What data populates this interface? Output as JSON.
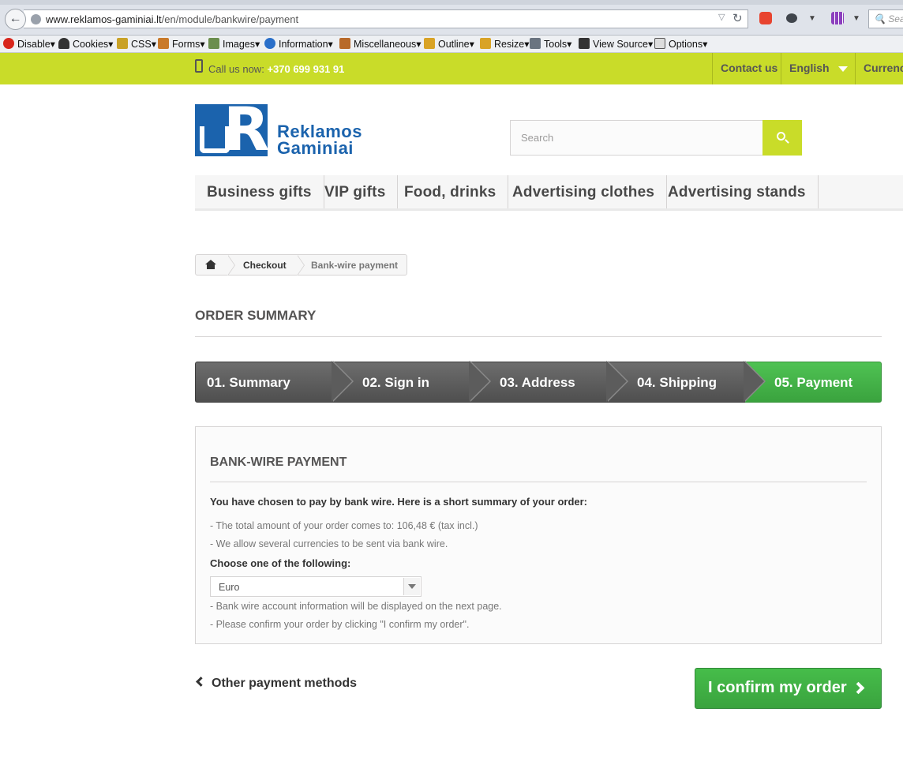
{
  "browser": {
    "url_host": "www.reklamos-gaminiai.lt",
    "url_path": "/en/module/bankwire/payment",
    "search_placeholder": "Sea"
  },
  "devtoolbar": {
    "items": [
      "Disable▾",
      "Cookies▾",
      "CSS▾",
      "Forms▾",
      "Images▾",
      "Information▾",
      "Miscellaneous▾",
      "Outline▾",
      "Resize▾",
      "Tools▾",
      "View Source▾",
      "Options▾"
    ]
  },
  "topbar": {
    "call_label": "Call us now:",
    "phone": "+370 699 931 91",
    "contact": "Contact us",
    "language": "English",
    "currency": "Currenc"
  },
  "logo": {
    "line1": "Reklamos",
    "line2": "Gaminiai"
  },
  "search": {
    "placeholder": "Search"
  },
  "menu": [
    "Business gifts",
    "VIP gifts",
    "Food, drinks",
    "Advertising clothes",
    "Advertising stands"
  ],
  "breadcrumb": {
    "checkout": "Checkout",
    "current": "Bank-wire payment"
  },
  "order_title": "ORDER SUMMARY",
  "steps": [
    "01. Summary",
    "02. Sign in",
    "03. Address",
    "04. Shipping",
    "05. Payment"
  ],
  "active_step": 5,
  "colors": {
    "accent": "#c9dc29",
    "active_step": "#46bd4a",
    "brand_blue": "#1b63ad"
  },
  "payment": {
    "title": "BANK-WIRE PAYMENT",
    "intro": "You have chosen to pay by bank wire. Here is a short summary of your order:",
    "total_line": "- The total amount of your order comes to: 106,48 € (tax incl.)",
    "currencies_line": "- We allow several currencies to be sent via bank wire.",
    "choose_label": "Choose one of the following:",
    "selected_currency": "Euro",
    "info_line": "- Bank wire account information will be displayed on the next page.",
    "confirm_line": "- Please confirm your order by clicking \"I confirm my order\"."
  },
  "actions": {
    "other_methods": "Other payment methods",
    "confirm": "I confirm my order"
  }
}
